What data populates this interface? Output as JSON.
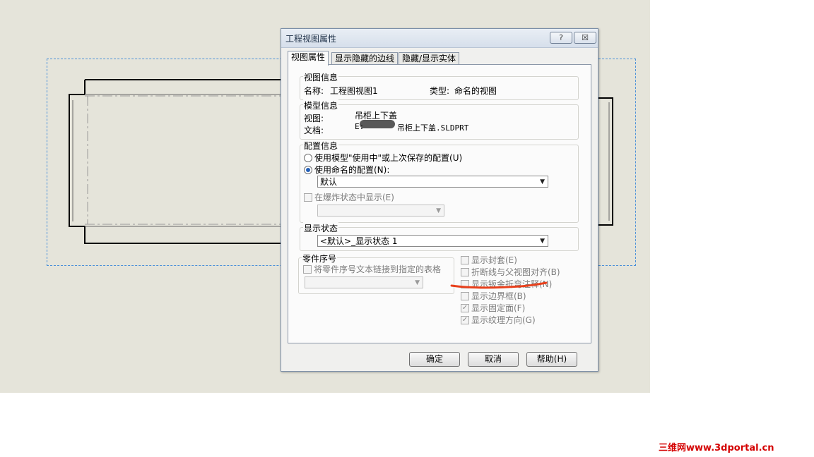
{
  "dialog": {
    "title": "工程视图属性",
    "help_btn": "?",
    "close_btn": "☒",
    "tabs": [
      "视图属性",
      "显示隐藏的边线",
      "隐藏/显示实体"
    ]
  },
  "view_info": {
    "label": "视图信息",
    "name_label": "名称:",
    "name_value": "工程图视图1",
    "type_label": "类型:",
    "type_value": "命名的视图"
  },
  "model_info": {
    "label": "模型信息",
    "view_label": "视图:",
    "view_value": "吊柜上下盖",
    "doc_label": "文档:",
    "doc_value_prefix": "E:",
    "doc_value_suffix": "吊柜上下盖.SLDPRT"
  },
  "config_info": {
    "label": "配置信息",
    "option1": "使用模型\"使用中\"或上次保存的配置(U)",
    "option2": "使用命名的配置(N):",
    "selected_config": "默认",
    "exploded_label": "在爆炸状态中显示(E)"
  },
  "display_state": {
    "label": "显示状态",
    "value": "<默认>_显示状态 1"
  },
  "balloon": {
    "label": "零件序号",
    "link_label": "将零件序号文本链接到指定的表格"
  },
  "options": [
    {
      "label": "显示封套(E)",
      "checked": false
    },
    {
      "label": "折断线与父视图对齐(B)",
      "checked": false
    },
    {
      "label": "显示钣金折弯注释(N)",
      "checked": false
    },
    {
      "label": "显示边界框(B)",
      "checked": false
    },
    {
      "label": "显示固定面(F)",
      "checked": true
    },
    {
      "label": "显示纹理方向(G)",
      "checked": true
    }
  ],
  "buttons": {
    "ok": "确定",
    "cancel": "取消",
    "help": "帮助(H)"
  },
  "watermark": "三维网www.3dportal.cn",
  "colors": {
    "canvas": "#e5e4da",
    "selection": "#4a90d9",
    "annotation": "#e8401c",
    "watermark": "#d40000"
  }
}
